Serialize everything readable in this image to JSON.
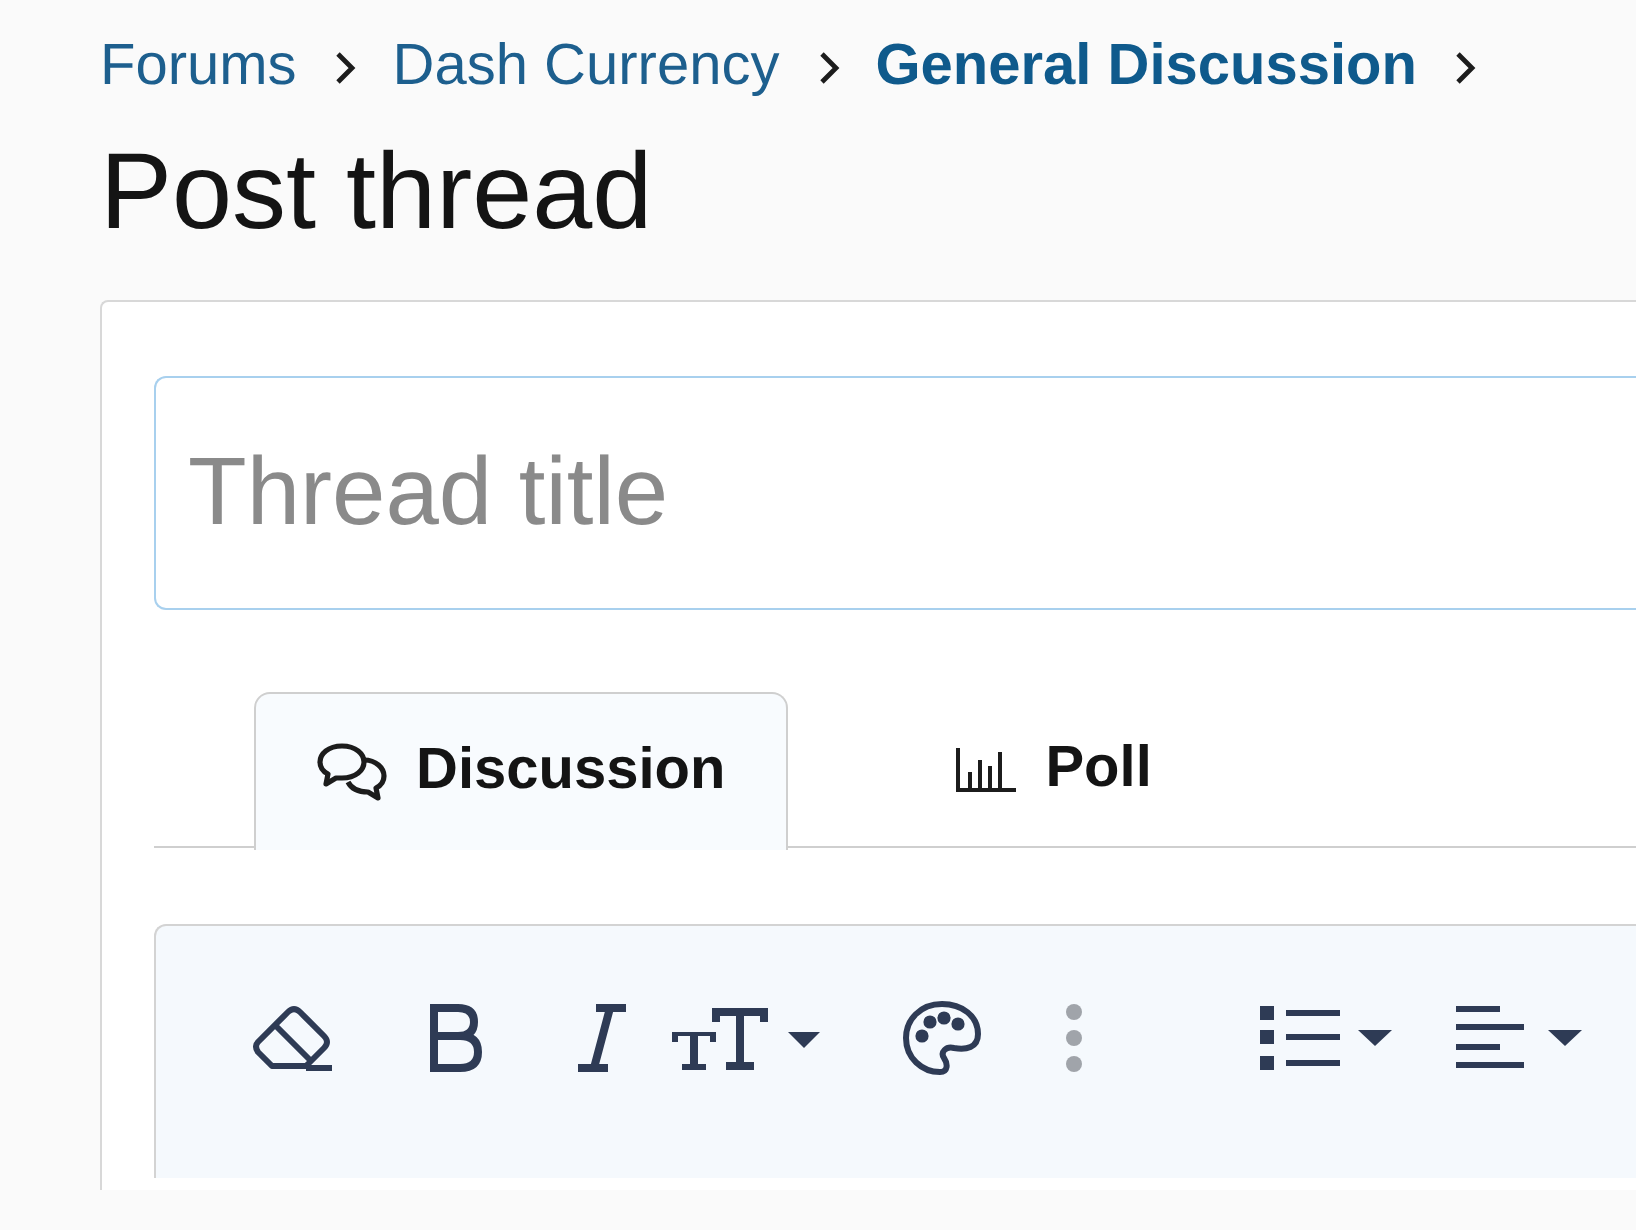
{
  "breadcrumbs": [
    {
      "label": "Forums",
      "current": false
    },
    {
      "label": "Dash Currency",
      "current": false
    },
    {
      "label": "General Discussion",
      "current": true
    }
  ],
  "page_title": "Post thread",
  "title_field": {
    "placeholder": "Thread title"
  },
  "tabs": [
    {
      "label": "Discussion",
      "kind": "discussion",
      "selected": true
    },
    {
      "label": "Poll",
      "kind": "poll",
      "selected": false
    }
  ]
}
